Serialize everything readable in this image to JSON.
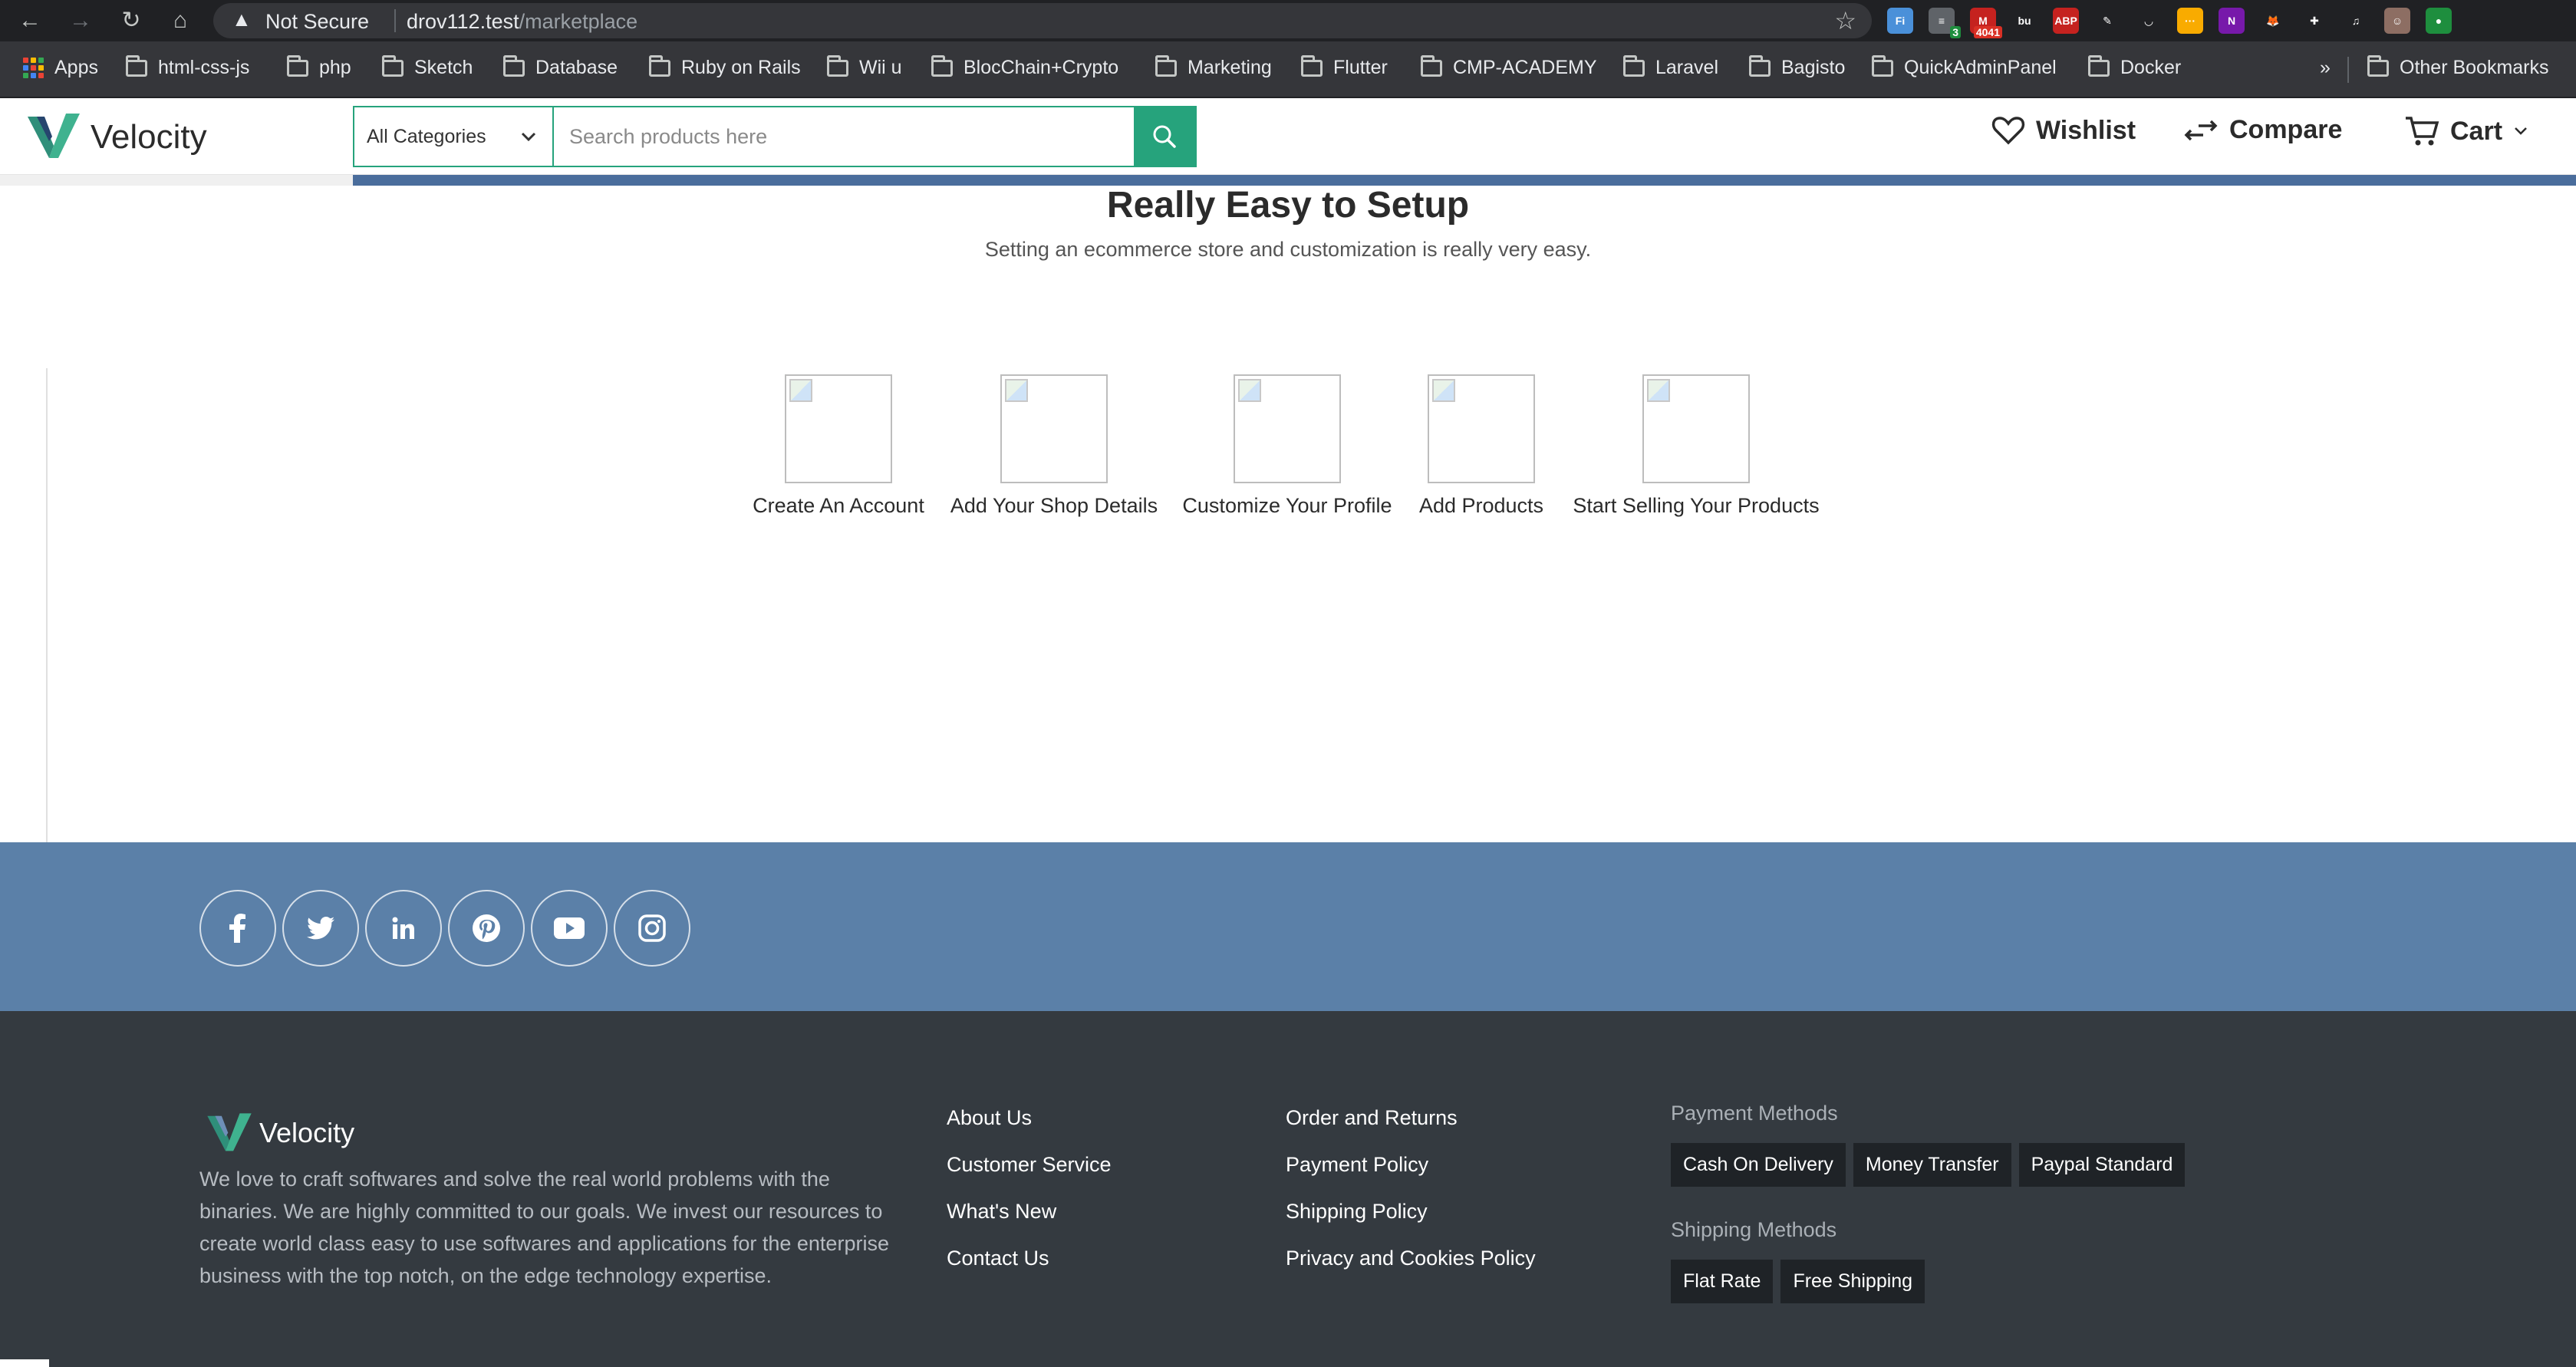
{
  "browser": {
    "security_label": "Not Secure",
    "url_host": "drov112.test",
    "url_path": "/marketplace",
    "extensions": [
      {
        "name": "ext-f",
        "glyph": "Fi",
        "color": "#4a90d9",
        "badge": ""
      },
      {
        "name": "ext-list",
        "glyph": "≡",
        "color": "#5f6368",
        "badge": "3"
      },
      {
        "name": "ext-mail",
        "glyph": "M",
        "color": "#c5221f",
        "badge": "4041"
      },
      {
        "name": "ext-bu",
        "glyph": "bu",
        "color": "#202124",
        "badge": ""
      },
      {
        "name": "ext-abp",
        "glyph": "ABP",
        "color": "#c5221f",
        "badge": ""
      },
      {
        "name": "ext-pen",
        "glyph": "✎",
        "color": "#202124",
        "badge": ""
      },
      {
        "name": "ext-pocket",
        "glyph": "◡",
        "color": "#202124",
        "badge": ""
      },
      {
        "name": "ext-notes",
        "glyph": "···",
        "color": "#f9ab00",
        "badge": ""
      },
      {
        "name": "ext-onenote",
        "glyph": "N",
        "color": "#7719aa",
        "badge": ""
      },
      {
        "name": "ext-fox",
        "glyph": "🦊",
        "color": "#202124",
        "badge": ""
      },
      {
        "name": "ext-puzzle",
        "glyph": "✚",
        "color": "#202124",
        "badge": ""
      },
      {
        "name": "ext-media",
        "glyph": "♫",
        "color": "#202124",
        "badge": ""
      },
      {
        "name": "ext-profile",
        "glyph": "☺",
        "color": "#8d6e63",
        "badge": ""
      },
      {
        "name": "ext-dot",
        "glyph": "●",
        "color": "#1e8e3e",
        "badge": ""
      }
    ]
  },
  "bookmarks": {
    "apps_label": "Apps",
    "items": [
      "html-css-js",
      "php",
      "Sketch",
      "Database",
      "Ruby on Rails",
      "Wii u",
      "BlocChain+Crypto",
      "Marketing",
      "Flutter",
      "CMP-ACADEMY",
      "Laravel",
      "Bagisto",
      "QuickAdminPanel",
      "Docker"
    ],
    "overflow_label": "»",
    "other_label": "Other Bookmarks"
  },
  "header": {
    "logo_text": "Velocity",
    "category_label": "All Categories",
    "search_placeholder": "Search products here",
    "wishlist_label": "Wishlist",
    "compare_label": "Compare",
    "cart_label": "Cart",
    "accent_color": "#26a37c"
  },
  "main": {
    "title": "Really Easy to Setup",
    "subtitle": "Setting an ecommerce store and customization is really very easy.",
    "steps": [
      {
        "label": "Create An Account"
      },
      {
        "label": "Add Your Shop Details"
      },
      {
        "label": "Customize Your Profile"
      },
      {
        "label": "Add Products"
      },
      {
        "label": "Start Selling Your Products"
      }
    ]
  },
  "social": {
    "band_color": "#5b80a8",
    "icons": [
      "facebook-icon",
      "twitter-icon",
      "linkedin-icon",
      "pinterest-icon",
      "youtube-icon",
      "instagram-icon"
    ]
  },
  "footer": {
    "logo_text": "Velocity",
    "about": "We love to craft softwares and solve the real world problems with the binaries. We are highly committed to our goals. We invest our resources to create world class easy to use softwares and applications for the enterprise business with the top notch, on the edge technology expertise.",
    "links_col1": [
      "About Us",
      "Customer Service",
      "What's New",
      "Contact Us"
    ],
    "links_col2": [
      "Order and Returns",
      "Payment Policy",
      "Shipping Policy",
      "Privacy and Cookies Policy"
    ],
    "payment_heading": "Payment Methods",
    "payment_methods": [
      "Cash On Delivery",
      "Money Transfer",
      "Paypal Standard"
    ],
    "shipping_heading": "Shipping Methods",
    "shipping_methods": [
      "Flat Rate",
      "Free Shipping"
    ]
  }
}
